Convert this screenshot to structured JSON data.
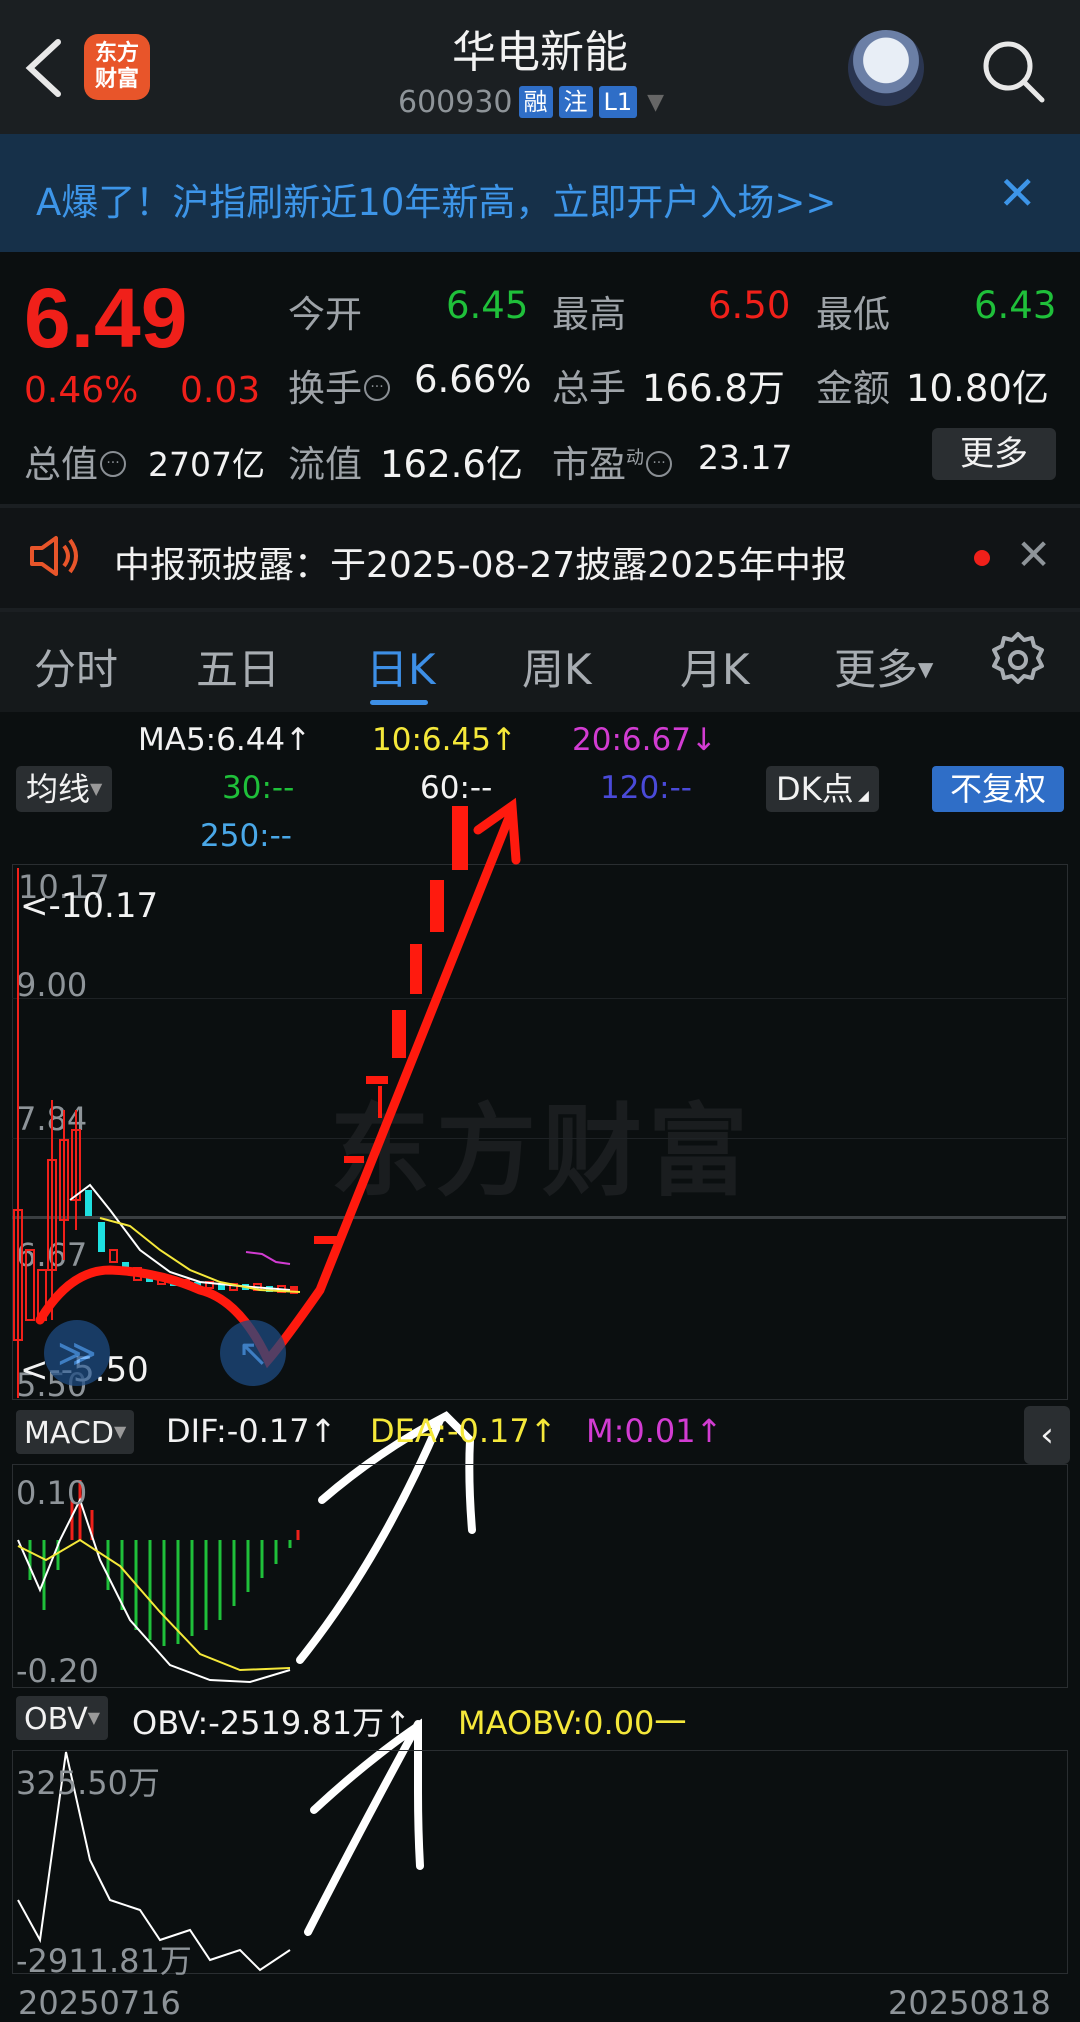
{
  "header": {
    "logo_text": "东方财富",
    "stock_name": "华电新能",
    "stock_code": "600930",
    "tags": [
      "融",
      "注",
      "L1"
    ]
  },
  "banner": {
    "text": "A爆了！沪指刷新近10年新高，立即开户入场>>",
    "close": "✕"
  },
  "quote": {
    "price": "6.49",
    "change_pct": "0.46%",
    "change": "0.03",
    "open_label": "今开",
    "open": "6.45",
    "high_label": "最高",
    "high": "6.50",
    "low_label": "最低",
    "low": "6.43",
    "turnover_label": "换手",
    "turnover": "6.66%",
    "volume_label": "总手",
    "volume": "166.8万",
    "amount_label": "金额",
    "amount": "10.80亿",
    "mktcap_label": "总值",
    "mktcap": "2707亿",
    "float_label": "流值",
    "float_cap": "162.6亿",
    "pe_label": "市盈",
    "pe_sup": "动",
    "pe": "23.17",
    "more_button": "更多"
  },
  "notice": {
    "text": "中报预披露：于2025-08-27披露2025年中报",
    "close": "✕"
  },
  "tabs": [
    "分时",
    "五日",
    "日K",
    "周K",
    "月K",
    "更多"
  ],
  "active_tab": "日K",
  "ma_line": {
    "ma5": "MA5:6.44↑",
    "ma10": "10:6.45↑",
    "ma20": "20:6.67↓",
    "ma30": "30:--",
    "ma60": "60:--",
    "ma120": "120:--",
    "ma250": "250:--",
    "selector": "均线",
    "dk_button": "DK点",
    "adjust_button": "不复权"
  },
  "kline_axis": {
    "top": "10.17",
    "max_marker": "<-10.17",
    "t1": "9.00",
    "t2": "7.84",
    "t3": "6.67",
    "bottom": "5.50",
    "min_marker": "<--5.50"
  },
  "macd": {
    "selector": "MACD",
    "dif": "DIF:-0.17↑",
    "dea": "DEA:-0.17↑",
    "m": "M:0.01↑",
    "top": "0.10",
    "bottom": "-0.20"
  },
  "obv": {
    "selector": "OBV",
    "obv": "OBV:-2519.81万↑",
    "maobv": "MAOBV:0.00一",
    "top": "325.50万",
    "bottom": "-2911.81万"
  },
  "dates": {
    "start": "20250716",
    "end": "20250818"
  },
  "watermark": "东方财富",
  "colors": {
    "up": "#f0201a",
    "down": "#1fc03a",
    "accent": "#3d8fe6",
    "ma5": "#ffffff",
    "ma10": "#f5e83a",
    "ma20": "#d23cd2"
  }
}
